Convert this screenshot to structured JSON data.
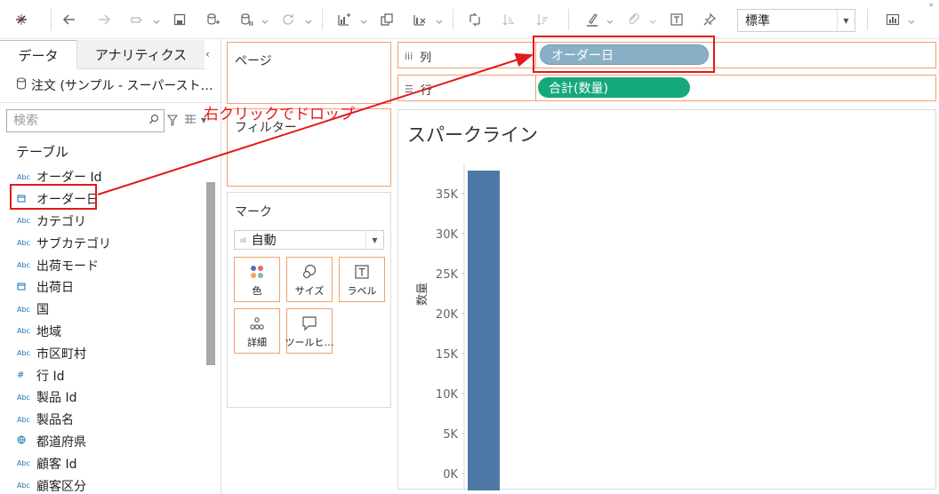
{
  "toolbar": {
    "fit_value": "標準",
    "icons": [
      "tableau-logo-icon",
      "undo-icon",
      "redo-icon",
      "replay-icon",
      "save-icon",
      "new-datasource-icon",
      "pause-updates-icon",
      "refresh-icon",
      "new-worksheet-icon",
      "duplicate-sheet-icon",
      "clear-sheet-icon",
      "swap-icon",
      "sort-ascending-icon",
      "sort-descending-icon",
      "highlight-icon",
      "group-icon",
      "label-icon",
      "pin-icon",
      "show-me-icon"
    ]
  },
  "datapane": {
    "tab_data": "データ",
    "tab_analytics": "アナリティクス",
    "datasource_name": "注文 (サンプル - スーパースト…",
    "search_placeholder": "検索",
    "section_title": "テーブル",
    "fields": [
      {
        "type": "abc",
        "label": "オーダー Id"
      },
      {
        "type": "date",
        "label": "オーダー日"
      },
      {
        "type": "abc",
        "label": "カテゴリ"
      },
      {
        "type": "abc",
        "label": "サブカテゴリ"
      },
      {
        "type": "abc",
        "label": "出荷モード"
      },
      {
        "type": "date",
        "label": "出荷日"
      },
      {
        "type": "abc",
        "label": "国"
      },
      {
        "type": "abc",
        "label": "地域"
      },
      {
        "type": "abc",
        "label": "市区町村"
      },
      {
        "type": "number",
        "label": "行 Id"
      },
      {
        "type": "abc",
        "label": "製品 Id"
      },
      {
        "type": "abc",
        "label": "製品名"
      },
      {
        "type": "geo",
        "label": "都道府県"
      },
      {
        "type": "abc",
        "label": "顧客 Id"
      },
      {
        "type": "abc",
        "label": "顧客区分"
      }
    ],
    "type_glyphs": {
      "abc": "Abc",
      "date": "📅",
      "number": "#",
      "geo": "⊕"
    }
  },
  "pages_card": {
    "title": "ページ"
  },
  "filters_card": {
    "title": "フィルター"
  },
  "marks_card": {
    "title": "マーク",
    "mark_type": "自動",
    "buttons": {
      "color": "色",
      "size": "サイズ",
      "label": "ラベル",
      "detail": "詳細",
      "tooltip": "ツールヒ…"
    }
  },
  "columns_shelf": {
    "label": "列",
    "pill": "オーダー日"
  },
  "rows_shelf": {
    "label": "行",
    "pill": "合計(数量)"
  },
  "annotation": {
    "text": "右クリックでドロップ",
    "color": "#e3191b"
  },
  "view": {
    "title": "スパークライン"
  },
  "chart_data": {
    "type": "bar",
    "title": "スパークライン",
    "categories": [
      ""
    ],
    "series": [
      {
        "values": [
          37873
        ]
      }
    ],
    "ylabel": "数量",
    "xlabel": "",
    "ylim": [
      0,
      37873
    ],
    "yticks": [
      0,
      5000,
      10000,
      15000,
      20000,
      25000,
      30000,
      35000
    ],
    "ytick_labels": [
      "0K",
      "5K",
      "10K",
      "15K",
      "20K",
      "25K",
      "30K",
      "35K"
    ],
    "bar_color": "#4e79a7",
    "grid": false
  }
}
